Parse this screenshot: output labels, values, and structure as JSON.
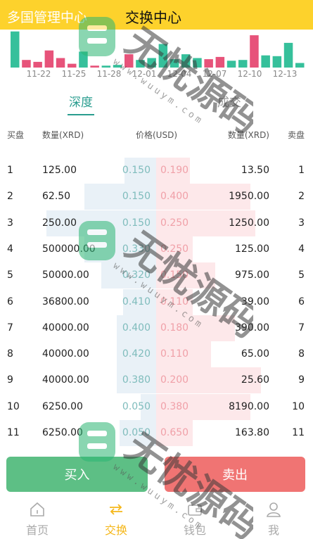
{
  "header": {
    "title_left": "多国管理中心",
    "title_center": "交换中心"
  },
  "colors": {
    "header_bg": "#fdd22c",
    "accent_teal": "#2a9d8f",
    "bar_green": "#36c09b",
    "bar_red": "#e7537a",
    "buy": "#5dbf85",
    "sell": "#f07473",
    "nav_active": "#f5b71a"
  },
  "mini_chart": {
    "bars": [
      {
        "v": 0.95,
        "c": "green"
      },
      {
        "v": 0.2,
        "c": "red"
      },
      {
        "v": 0.15,
        "c": "red"
      },
      {
        "v": 0.45,
        "c": "red"
      },
      {
        "v": 0.25,
        "c": "red"
      },
      {
        "v": 0.1,
        "c": "red"
      },
      {
        "v": 0.42,
        "c": "green"
      },
      {
        "v": 0.05,
        "c": "red"
      },
      {
        "v": 0.05,
        "c": "green"
      },
      {
        "v": 0.07,
        "c": "green"
      },
      {
        "v": 0.35,
        "c": "red"
      },
      {
        "v": 0.2,
        "c": "green"
      },
      {
        "v": 0.25,
        "c": "green"
      },
      {
        "v": 0.62,
        "c": "green"
      },
      {
        "v": 0.22,
        "c": "green"
      },
      {
        "v": 0.35,
        "c": "green"
      },
      {
        "v": 0.25,
        "c": "green"
      },
      {
        "v": 0.22,
        "c": "red"
      },
      {
        "v": 0.28,
        "c": "red"
      },
      {
        "v": 0.18,
        "c": "green"
      },
      {
        "v": 0.2,
        "c": "green"
      },
      {
        "v": 0.85,
        "c": "red"
      },
      {
        "v": 0.32,
        "c": "green"
      },
      {
        "v": 0.3,
        "c": "green"
      },
      {
        "v": 0.65,
        "c": "green"
      },
      {
        "v": 0.12,
        "c": "green"
      }
    ]
  },
  "date_labels": [
    "11-22",
    "11-25",
    "11-28",
    "12-01",
    "12-04",
    "12-07",
    "12-10",
    "12-13"
  ],
  "tabs": [
    {
      "label": "深度",
      "active": true
    },
    {
      "label": "成交",
      "active": false
    }
  ],
  "col_headers": {
    "buy": "买盘",
    "bid_qty": "数量(XRD)",
    "price": "价格(USD)",
    "ask_qty": "数量(XRD)",
    "sell": "卖盘"
  },
  "order_book": [
    {
      "idx": "1",
      "bid_qty": "125.00",
      "bid_price": "0.150",
      "ask_price": "0.190",
      "ask_qty": "13.50",
      "bid_depth": 0.24,
      "ask_depth": 0.26
    },
    {
      "idx": "2",
      "bid_qty": "62.50",
      "bid_price": "0.150",
      "ask_price": "0.400",
      "ask_qty": "1950.00",
      "bid_depth": 0.55,
      "ask_depth": 0.72
    },
    {
      "idx": "3",
      "bid_qty": "250.00",
      "bid_price": "0.150",
      "ask_price": "0.250",
      "ask_qty": "1250.00",
      "bid_depth": 0.84,
      "ask_depth": 0.76
    },
    {
      "idx": "4",
      "bid_qty": "500000.00",
      "bid_price": "0.330",
      "ask_price": "0.250",
      "ask_qty": "125.00",
      "bid_depth": 0.55,
      "ask_depth": 0.28
    },
    {
      "idx": "5",
      "bid_qty": "50000.00",
      "bid_price": "0.320",
      "ask_price": "0.150",
      "ask_qty": "975.00",
      "bid_depth": 0.42,
      "ask_depth": 0.45
    },
    {
      "idx": "6",
      "bid_qty": "36800.00",
      "bid_price": "0.410",
      "ask_price": "0.110",
      "ask_qty": "39.00",
      "bid_depth": 0.25,
      "ask_depth": 0.28
    },
    {
      "idx": "7",
      "bid_qty": "40000.00",
      "bid_price": "0.400",
      "ask_price": "0.180",
      "ask_qty": "390.00",
      "bid_depth": 0.3,
      "ask_depth": 0.6
    },
    {
      "idx": "8",
      "bid_qty": "40000.00",
      "bid_price": "0.420",
      "ask_price": "0.110",
      "ask_qty": "65.00",
      "bid_depth": 0.3,
      "ask_depth": 0.42
    },
    {
      "idx": "9",
      "bid_qty": "40000.00",
      "bid_price": "0.380",
      "ask_price": "0.200",
      "ask_qty": "25.60",
      "bid_depth": 0.3,
      "ask_depth": 0.8
    },
    {
      "idx": "10",
      "bid_qty": "6250.00",
      "bid_price": "0.050",
      "ask_price": "0.380",
      "ask_qty": "8190.00",
      "bid_depth": 0.12,
      "ask_depth": 0.72
    },
    {
      "idx": "11",
      "bid_qty": "6250.00",
      "bid_price": "0.050",
      "ask_price": "0.650",
      "ask_qty": "163.80",
      "bid_depth": 0.28,
      "ask_depth": 0.28
    }
  ],
  "buttons": {
    "buy": "买入",
    "sell": "卖出"
  },
  "nav": [
    {
      "label": "首页",
      "icon": "home-icon",
      "active": false
    },
    {
      "label": "交换",
      "icon": "exchange-icon",
      "active": true
    },
    {
      "label": "钱包",
      "icon": "wallet-icon",
      "active": false
    },
    {
      "label": "我",
      "icon": "user-icon",
      "active": false
    }
  ],
  "watermark": {
    "text": "无忧源码",
    "url": "www.wuuym.com"
  }
}
